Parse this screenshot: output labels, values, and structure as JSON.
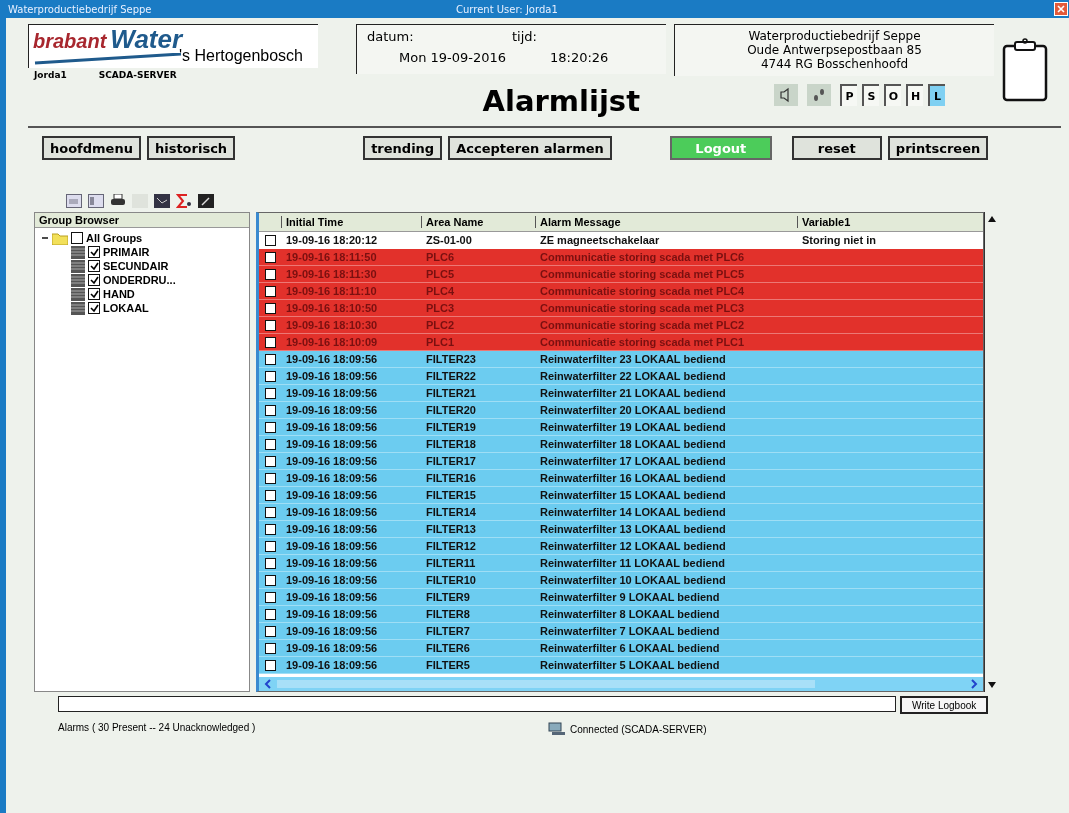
{
  "window": {
    "title": "Waterproductiebedrijf Seppe",
    "current_user": "Current User: Jorda1"
  },
  "logo": {
    "brand_1": "brabant",
    "brand_2": "Water",
    "city": "'s Hertogenbosch",
    "user": "Jorda1",
    "server": "SCADA-SERVER"
  },
  "datetime": {
    "date_label": "datum:",
    "date": "Mon 19-09-2016",
    "time_label": "tijd:",
    "time": "18:20:26"
  },
  "address": [
    "Waterproductiebedrijf Seppe",
    "Oude Antwerpsepostbaan 85",
    "4744 RG Bosschenhoofd"
  ],
  "page_title": "Alarmlijst",
  "indicators": [
    {
      "label": "P",
      "on": false
    },
    {
      "label": "S",
      "on": false
    },
    {
      "label": "O",
      "on": false
    },
    {
      "label": "H",
      "on": false
    },
    {
      "label": "L",
      "on": true
    }
  ],
  "nav_buttons": [
    {
      "label": "hoofdmenu",
      "kind": "normal"
    },
    {
      "label": "historisch",
      "kind": "normal"
    },
    {
      "label": "trending",
      "kind": "normal"
    },
    {
      "label": "Accepteren alarmen",
      "kind": "normal"
    },
    {
      "label": "Logout",
      "kind": "active"
    },
    {
      "label": "reset",
      "kind": "normal"
    },
    {
      "label": "printscreen",
      "kind": "normal"
    }
  ],
  "group_browser": {
    "title": "Group Browser",
    "tree": [
      {
        "label": "All Groups",
        "checked": false,
        "expanded": true,
        "children": [
          {
            "label": "PRIMAIR",
            "checked": true
          },
          {
            "label": "SECUNDAIR",
            "checked": true
          },
          {
            "label": "ONDERDRU...",
            "checked": true
          },
          {
            "label": "HAND",
            "checked": true
          },
          {
            "label": "LOKAAL",
            "checked": true
          }
        ]
      }
    ]
  },
  "table": {
    "columns": [
      "Initial Time",
      "Area Name",
      "Alarm Message",
      "Variable1"
    ],
    "rows": [
      {
        "time": "19-09-16 18:20:12",
        "area": "ZS-01-00",
        "message": "ZE magneetschakelaar",
        "variable": "Storing niet in",
        "color": "#ffffff",
        "checked": false
      },
      {
        "time": "19-09-16 18:11:50",
        "area": "PLC6",
        "message": "Communicatie storing scada met PLC6",
        "color": "#e2312b",
        "checked": false
      },
      {
        "time": "19-09-16 18:11:30",
        "area": "PLC5",
        "message": "Communicatie storing scada met PLC5",
        "color": "#e2312b",
        "checked": false
      },
      {
        "time": "19-09-16 18:11:10",
        "area": "PLC4",
        "message": "Communicatie storing scada met PLC4",
        "color": "#e2312b",
        "checked": false
      },
      {
        "time": "19-09-16 18:10:50",
        "area": "PLC3",
        "message": "Communicatie storing scada met PLC3",
        "color": "#e2312b",
        "checked": false
      },
      {
        "time": "19-09-16 18:10:30",
        "area": "PLC2",
        "message": "Communicatie storing scada met PLC2",
        "color": "#e2312b",
        "checked": false
      },
      {
        "time": "19-09-16 18:10:09",
        "area": "PLC1",
        "message": "Communicatie storing scada met PLC1",
        "color": "#e2312b",
        "checked": false
      },
      {
        "time": "19-09-16 18:09:56",
        "area": "FILTER23",
        "message": "Reinwaterfilter 23 LOKAAL bediend",
        "color": "#6cccf0",
        "checked": false
      },
      {
        "time": "19-09-16 18:09:56",
        "area": "FILTER22",
        "message": "Reinwaterfilter 22 LOKAAL bediend",
        "color": "#6cccf0",
        "checked": false
      },
      {
        "time": "19-09-16 18:09:56",
        "area": "FILTER21",
        "message": "Reinwaterfilter 21 LOKAAL bediend",
        "color": "#6cccf0",
        "checked": false
      },
      {
        "time": "19-09-16 18:09:56",
        "area": "FILTER20",
        "message": "Reinwaterfilter 20 LOKAAL bediend",
        "color": "#6cccf0",
        "checked": false
      },
      {
        "time": "19-09-16 18:09:56",
        "area": "FILTER19",
        "message": "Reinwaterfilter 19 LOKAAL bediend",
        "color": "#6cccf0",
        "checked": false
      },
      {
        "time": "19-09-16 18:09:56",
        "area": "FILTER18",
        "message": "Reinwaterfilter 18 LOKAAL bediend",
        "color": "#6cccf0",
        "checked": false
      },
      {
        "time": "19-09-16 18:09:56",
        "area": "FILTER17",
        "message": "Reinwaterfilter 17 LOKAAL bediend",
        "color": "#6cccf0",
        "checked": false
      },
      {
        "time": "19-09-16 18:09:56",
        "area": "FILTER16",
        "message": "Reinwaterfilter 16 LOKAAL bediend",
        "color": "#6cccf0",
        "checked": false
      },
      {
        "time": "19-09-16 18:09:56",
        "area": "FILTER15",
        "message": "Reinwaterfilter 15 LOKAAL bediend",
        "color": "#6cccf0",
        "checked": false
      },
      {
        "time": "19-09-16 18:09:56",
        "area": "FILTER14",
        "message": "Reinwaterfilter 14 LOKAAL bediend",
        "color": "#6cccf0",
        "checked": false
      },
      {
        "time": "19-09-16 18:09:56",
        "area": "FILTER13",
        "message": "Reinwaterfilter 13 LOKAAL bediend",
        "color": "#6cccf0",
        "checked": false
      },
      {
        "time": "19-09-16 18:09:56",
        "area": "FILTER12",
        "message": "Reinwaterfilter 12 LOKAAL bediend",
        "color": "#6cccf0",
        "checked": false
      },
      {
        "time": "19-09-16 18:09:56",
        "area": "FILTER11",
        "message": "Reinwaterfilter 11 LOKAAL bediend",
        "color": "#6cccf0",
        "checked": false
      },
      {
        "time": "19-09-16 18:09:56",
        "area": "FILTER10",
        "message": "Reinwaterfilter 10 LOKAAL bediend",
        "color": "#6cccf0",
        "checked": false
      },
      {
        "time": "19-09-16 18:09:56",
        "area": "FILTER9",
        "message": "Reinwaterfilter 9 LOKAAL bediend",
        "color": "#6cccf0",
        "checked": false
      },
      {
        "time": "19-09-16 18:09:56",
        "area": "FILTER8",
        "message": "Reinwaterfilter 8 LOKAAL bediend",
        "color": "#6cccf0",
        "checked": false
      },
      {
        "time": "19-09-16 18:09:56",
        "area": "FILTER7",
        "message": "Reinwaterfilter 7 LOKAAL bediend",
        "color": "#6cccf0",
        "checked": false
      },
      {
        "time": "19-09-16 18:09:56",
        "area": "FILTER6",
        "message": "Reinwaterfilter 6 LOKAAL bediend",
        "color": "#6cccf0",
        "checked": false
      },
      {
        "time": "19-09-16 18:09:56",
        "area": "FILTER5",
        "message": "Reinwaterfilter 5 LOKAAL bediend",
        "color": "#6cccf0",
        "checked": false
      }
    ]
  },
  "logbook": {
    "button": "Write Logbook"
  },
  "status_bar": {
    "alarms": "Alarms  ( 30 Present -- 24 Unacknowledged )",
    "connection": "Connected (SCADA-SERVER)"
  }
}
